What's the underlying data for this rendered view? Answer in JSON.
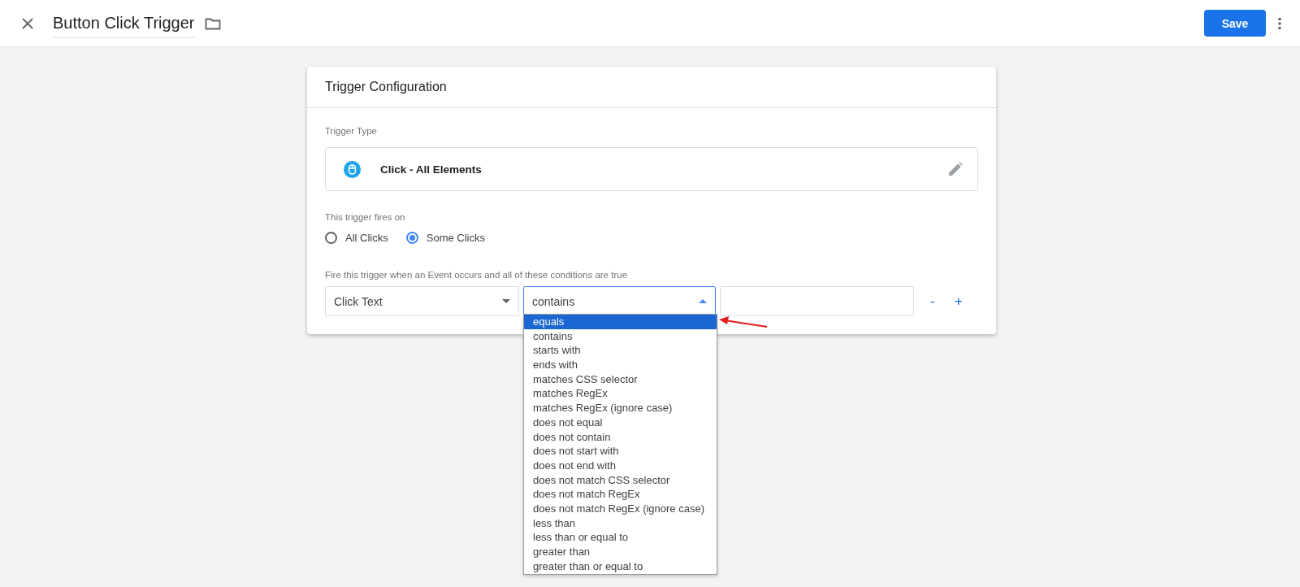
{
  "header": {
    "title": "Button Click Trigger",
    "save_button": "Save"
  },
  "card": {
    "title": "Trigger Configuration",
    "trigger_type_label": "Trigger Type",
    "trigger_type": "Click - All Elements",
    "fires_on_label": "This trigger fires on",
    "fires_on_options": [
      {
        "label": "All Clicks",
        "selected": false
      },
      {
        "label": "Some Clicks",
        "selected": true
      }
    ],
    "conditions_label": "Fire this trigger when an Event occurs and all of these conditions are true",
    "condition": {
      "variable": "Click Text",
      "operator": "contains",
      "operator_expanded": true,
      "remove_button": "-",
      "add_button": "+"
    },
    "operator_options": [
      {
        "label": "equals",
        "selected": true
      },
      {
        "label": "contains",
        "selected": false
      },
      {
        "label": "starts with",
        "selected": false
      },
      {
        "label": "ends with",
        "selected": false
      },
      {
        "label": "matches CSS selector",
        "selected": false
      },
      {
        "label": "matches RegEx",
        "selected": false
      },
      {
        "label": "matches RegEx (ignore case)",
        "selected": false
      },
      {
        "label": "does not equal",
        "selected": false
      },
      {
        "label": "does not contain",
        "selected": false
      },
      {
        "label": "does not start with",
        "selected": false
      },
      {
        "label": "does not end with",
        "selected": false
      },
      {
        "label": "does not match CSS selector",
        "selected": false
      },
      {
        "label": "does not match RegEx",
        "selected": false
      },
      {
        "label": "does not match RegEx (ignore case)",
        "selected": false
      },
      {
        "label": "less than",
        "selected": false
      },
      {
        "label": "less than or equal to",
        "selected": false
      },
      {
        "label": "greater than",
        "selected": false
      },
      {
        "label": "greater than or equal to",
        "selected": false
      }
    ]
  }
}
